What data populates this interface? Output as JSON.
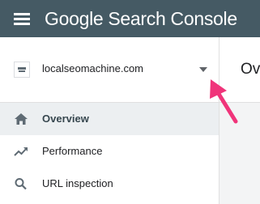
{
  "header": {
    "logo_text": "Google",
    "product_text": "Search Console",
    "colors": {
      "bar": "#455a64",
      "text": "#ffffff"
    }
  },
  "property_selector": {
    "name": "localseomachine.com",
    "icon": "site-favicon"
  },
  "nav": {
    "items": [
      {
        "label": "Overview",
        "icon": "home-icon",
        "active": true
      },
      {
        "label": "Performance",
        "icon": "trending-up-icon",
        "active": false
      },
      {
        "label": "URL inspection",
        "icon": "search-icon",
        "active": false
      }
    ]
  },
  "main": {
    "title": "Ov"
  },
  "annotation": {
    "color": "#f0347a"
  }
}
